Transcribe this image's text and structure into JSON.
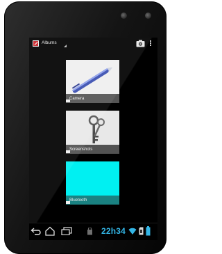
{
  "action_bar": {
    "title": "Albums",
    "app_icon": "gallery-app-icon",
    "camera_icon": "camera-icon",
    "overflow_icon": "overflow-menu-icon"
  },
  "albums": [
    {
      "label": "Camera",
      "thumb": "blue-pen-photo"
    },
    {
      "label": "Screenshots",
      "thumb": "keys-photo"
    },
    {
      "label": "Bluetooth",
      "thumb": "cyan-placeholder"
    }
  ],
  "system_bar": {
    "clock": "22h34",
    "icons": [
      "back-icon",
      "home-icon",
      "recent-apps-icon",
      "notification-icon",
      "wifi-icon",
      "sd-card-icon",
      "battery-icon"
    ]
  },
  "colors": {
    "accent": "#33b5e5",
    "bluetooth_thumb": "#00f0f2",
    "app_icon": "#c8262b"
  }
}
